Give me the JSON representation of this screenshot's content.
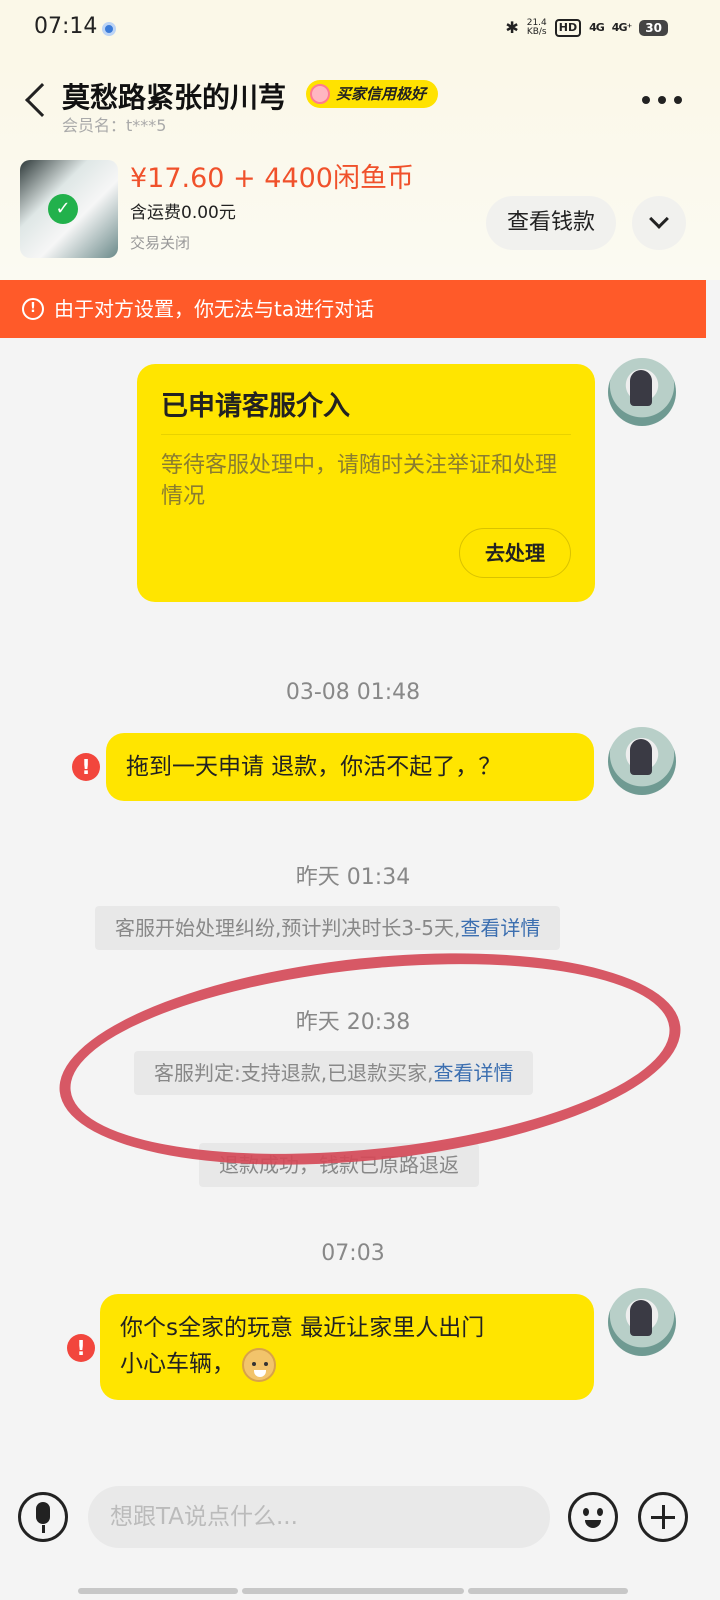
{
  "status_bar": {
    "time": "07:14",
    "net_speed": "21.4",
    "net_unit": "KB/s",
    "hd": "HD",
    "sig1": "4G",
    "sig2": "4G⁺",
    "battery": "30"
  },
  "header": {
    "nickname": "莫愁路紧张的川芎",
    "credit_badge": "买家信用极好",
    "member_label": "会员名：t***5",
    "product": {
      "price": "¥17.60 + 4400闲鱼币",
      "shipping": "含运费0.00元",
      "status": "交易关闭"
    },
    "view_money_button": "查看钱款"
  },
  "notice": "由于对方设置，你无法与ta进行对话",
  "card": {
    "title": "已申请客服介入",
    "body": "等待客服处理中，请随时关注举证和处理情况",
    "action": "去处理"
  },
  "messages": {
    "ts1": "03-08 01:48",
    "bubble1": "拖到一天申请 退款，你活不起了，？",
    "ts2": "昨天 01:34",
    "sys1_text": "客服开始处理纠纷,预计判决时长3-5天,",
    "sys1_link": "查看详情",
    "ts3": "昨天 20:38",
    "sys2_text": "客服判定:支持退款,已退款买家,",
    "sys2_link": "查看详情",
    "sys3_text": "退款成功，钱款已原路退返",
    "ts4": "07:03",
    "bubble2_line1": "你个s全家的玩意 最近让家里人出门",
    "bubble2_line2": "小心车辆，"
  },
  "input": {
    "placeholder": "想跟TA说点什么..."
  },
  "colors": {
    "accent_yellow": "#ffe500",
    "notice_orange": "#ff5a29",
    "price_red": "#f0512b",
    "link_blue": "#3c6fb0",
    "annotation_red": "#d44a58"
  }
}
